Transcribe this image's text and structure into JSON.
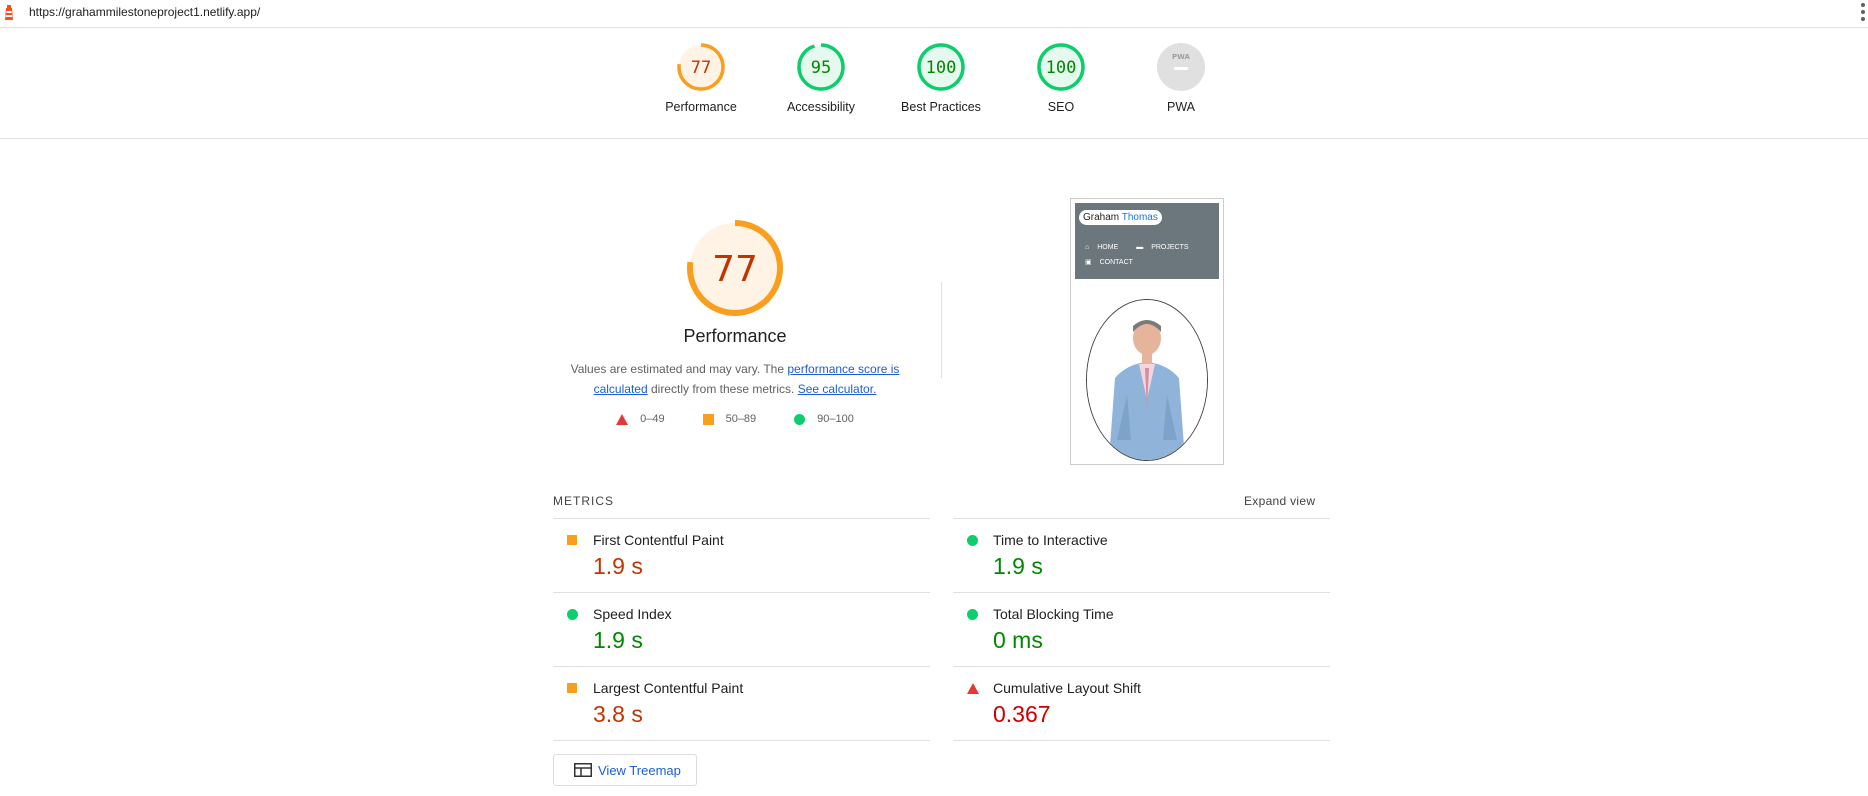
{
  "topbar": {
    "url": "https://grahammilestoneproject1.netlify.app/"
  },
  "colors": {
    "fail": "#e53935",
    "average": "#fa9f1d",
    "pass": "#0cce6b",
    "average_text": "#c33300",
    "pass_text": "#008800",
    "fail_text": "#cc0000",
    "pwa": "#9e9e9e"
  },
  "gauges": [
    {
      "label": "Performance",
      "score": "77",
      "fraction": 0.77,
      "rating": "average"
    },
    {
      "label": "Accessibility",
      "score": "95",
      "fraction": 0.95,
      "rating": "pass"
    },
    {
      "label": "Best Practices",
      "score": "100",
      "fraction": 1.0,
      "rating": "pass"
    },
    {
      "label": "SEO",
      "score": "100",
      "fraction": 1.0,
      "rating": "pass"
    },
    {
      "label": "PWA",
      "score": "",
      "fraction": 0,
      "rating": "pwa",
      "icon_text": "PWA"
    }
  ],
  "performance": {
    "score": "77",
    "fraction": 0.77,
    "label": "Performance",
    "desc_prefix": "Values are estimated and may vary. The ",
    "desc_link1": "performance score is calculated",
    "desc_middle": " directly from these metrics. ",
    "desc_link2": "See calculator."
  },
  "legend": {
    "fail": "0–49",
    "average": "50–89",
    "pass": "90–100"
  },
  "screenshot": {
    "brand_first": "Graham",
    "brand_last": "Thomas",
    "nav": [
      "HOME",
      "PROJECTS",
      "CONTACT"
    ]
  },
  "metrics": {
    "title": "METRICS",
    "expand": "Expand view",
    "left": [
      {
        "label": "First Contentful Paint",
        "value": "1.9 s",
        "rating": "average"
      },
      {
        "label": "Speed Index",
        "value": "1.9 s",
        "rating": "pass"
      },
      {
        "label": "Largest Contentful Paint",
        "value": "3.8 s",
        "rating": "average"
      }
    ],
    "right": [
      {
        "label": "Time to Interactive",
        "value": "1.9 s",
        "rating": "pass"
      },
      {
        "label": "Total Blocking Time",
        "value": "0 ms",
        "rating": "pass"
      },
      {
        "label": "Cumulative Layout Shift",
        "value": "0.367",
        "rating": "fail"
      }
    ]
  },
  "treemap": {
    "label": "View Treemap"
  }
}
